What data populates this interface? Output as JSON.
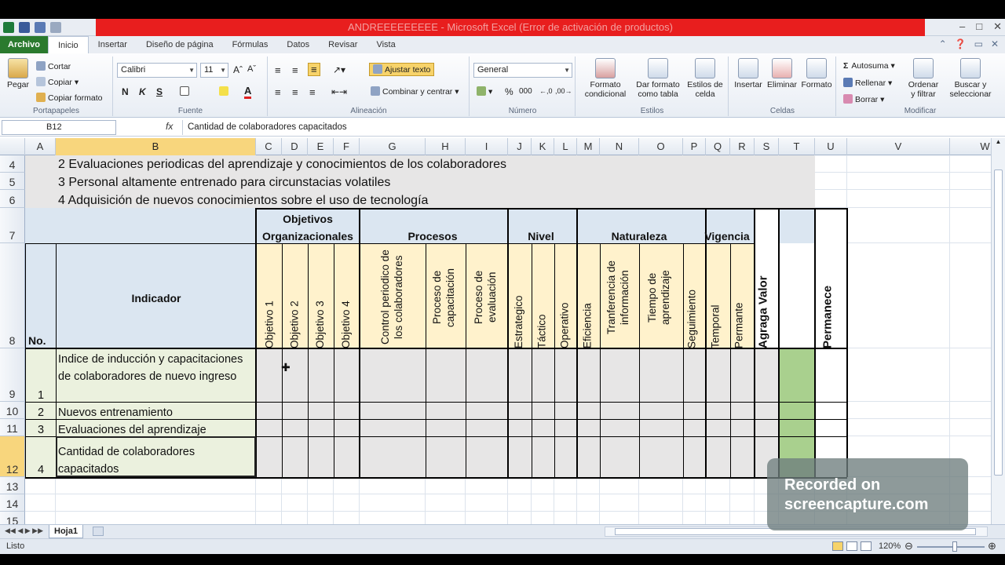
{
  "window": {
    "title": "ANDREEEEEEEEE  -  Microsoft Excel (Error de activación de productos)"
  },
  "tabs": [
    "Archivo",
    "Inicio",
    "Insertar",
    "Diseño de página",
    "Fórmulas",
    "Datos",
    "Revisar",
    "Vista"
  ],
  "ribbon": {
    "portapapeles": {
      "label": "Portapapeles",
      "pegar": "Pegar",
      "cortar": "Cortar",
      "copiar": "Copiar",
      "copiar_formato": "Copiar formato"
    },
    "fuente": {
      "label": "Fuente",
      "font": "Calibri",
      "size": "11",
      "bold": "N",
      "italic": "K",
      "underline": "S"
    },
    "alineacion": {
      "label": "Alineación",
      "ajustar": "Ajustar texto",
      "combinar": "Combinar y centrar"
    },
    "numero": {
      "label": "Número",
      "format": "General",
      "percent": "%",
      "thousands": "000"
    },
    "estilos": {
      "label": "Estilos",
      "formato_condicional_1": "Formato",
      "formato_condicional_2": "condicional",
      "dar_formato_1": "Dar formato",
      "dar_formato_2": "como tabla",
      "estilos_celda_1": "Estilos de",
      "estilos_celda_2": "celda"
    },
    "celdas": {
      "label": "Celdas",
      "insertar": "Insertar",
      "eliminar": "Eliminar",
      "formato": "Formato"
    },
    "modificar": {
      "label": "Modificar",
      "autosuma": "Autosuma",
      "rellenar": "Rellenar",
      "borrar": "Borrar",
      "ordenar_1": "Ordenar",
      "ordenar_2": "y filtrar",
      "buscar_1": "Buscar y",
      "buscar_2": "seleccionar"
    }
  },
  "formula_bar": {
    "name_box": "B12",
    "fx": "fx",
    "content": "Cantidad de colaboradores capacitados"
  },
  "columns": [
    "A",
    "B",
    "C",
    "D",
    "E",
    "F",
    "G",
    "H",
    "I",
    "J",
    "K",
    "L",
    "M",
    "N",
    "O",
    "P",
    "Q",
    "R",
    "S",
    "T",
    "U",
    "V",
    "W"
  ],
  "rows": [
    "4",
    "5",
    "6",
    "7",
    "8",
    "9",
    "10",
    "11",
    "12",
    "13",
    "14",
    "15"
  ],
  "sheet": {
    "lines": [
      "2 Evaluaciones periodicas del aprendizaje y conocimientos de los colaboradores",
      "3 Personal altamente entrenado para circunstacias volatiles",
      "4 Adquisición de nuevos conocimientos sobre el uso de tecnología"
    ],
    "group_headers": {
      "objetivos": "Objetivos Organizacionales",
      "procesos": "Procesos",
      "nivel": "Nivel",
      "naturaleza": "Naturaleza",
      "vigencia": "Vigencia"
    },
    "no_label": "No.",
    "indicador_label": "Indicador",
    "vertical_headers": {
      "obj1": "Objetivo 1",
      "obj2": "Objetivo 2",
      "obj3": "Objetivo 3",
      "obj4": "Objetivo 4",
      "control": "Control periodico de los colaboradores",
      "cap": "Proceso de capacitación",
      "eval": "Proceso de evaluación",
      "estrategico": "Estrategico",
      "tactico": "Táctico",
      "operativo": "Operativo",
      "eficiencia": "Eficiencia",
      "transferencia": "Tranferencia de información",
      "tiempo": "Tiempo de aprendizaje",
      "seguimiento": "Seguimiento",
      "temporal": "Temporal",
      "permanente": "Permante",
      "agrega": "Agraga Valor",
      "permanece": "Permanece"
    },
    "indicators": [
      {
        "no": "1",
        "name": "Indice de inducción y capacitaciones de colaboradores de nuevo ingreso"
      },
      {
        "no": "2",
        "name": "Nuevos entrenamiento"
      },
      {
        "no": "3",
        "name": "Evaluaciones del aprendizaje"
      },
      {
        "no": "4",
        "name": "Cantidad de colaboradores capacitados"
      }
    ]
  },
  "sheet_tab": "Hoja1",
  "status": {
    "text": "Listo",
    "zoom": "120%"
  },
  "watermark": {
    "line1": "Recorded on",
    "line2": "screencapture.com"
  },
  "colors": {
    "excel_green": "#2a7a2e",
    "header_blue": "#dbe6f1",
    "header_yellow": "#fff2cc",
    "indicator_green": "#ebf1de",
    "fill_green": "#a9d08e",
    "gray": "#e7e6e6"
  }
}
